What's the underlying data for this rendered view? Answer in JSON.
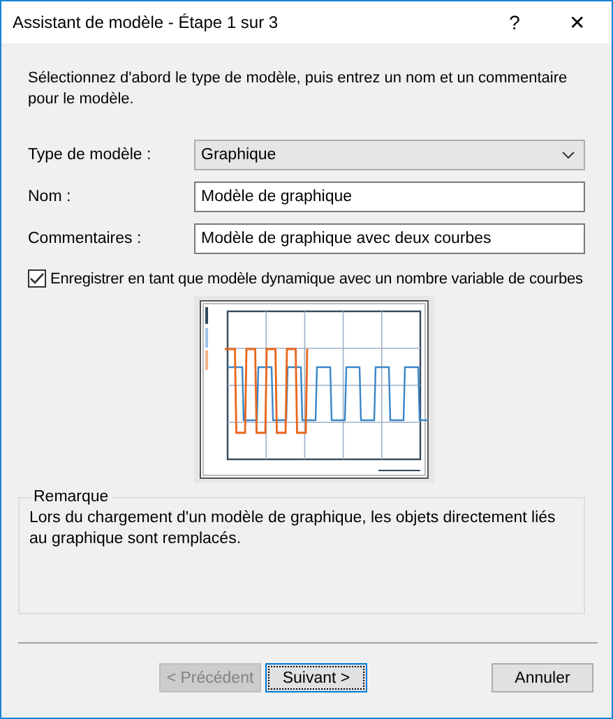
{
  "window": {
    "title": "Assistant de modèle - Étape 1 sur 3",
    "help": "?",
    "close": "✕"
  },
  "intro": "Sélectionnez d'abord le type de modèle, puis entrez un nom et un commentaire pour le modèle.",
  "fields": [
    {
      "kind": "dropdown",
      "label": "Type de modèle :",
      "value": "Graphique"
    },
    {
      "kind": "text",
      "label": "Nom :",
      "value": "Modèle de graphique"
    },
    {
      "kind": "text",
      "label": "Commentaires :",
      "value": "Modèle de graphique avec deux courbes"
    }
  ],
  "dynamic_option": {
    "label": "Enregistrer en tant que modèle dynamique avec un nombre variable de courbes",
    "checked": true
  },
  "note": {
    "title": "Remarque",
    "text": "Lors du chargement d'un modèle de graphique, les objets directement liés au graphique sont remplacés."
  },
  "buttons": [
    {
      "label": "< Précédent",
      "disabled": true,
      "default": false
    },
    {
      "label": "Suivant >",
      "disabled": false,
      "default": true
    },
    {
      "label": "Annuler",
      "disabled": false,
      "default": false
    }
  ]
}
